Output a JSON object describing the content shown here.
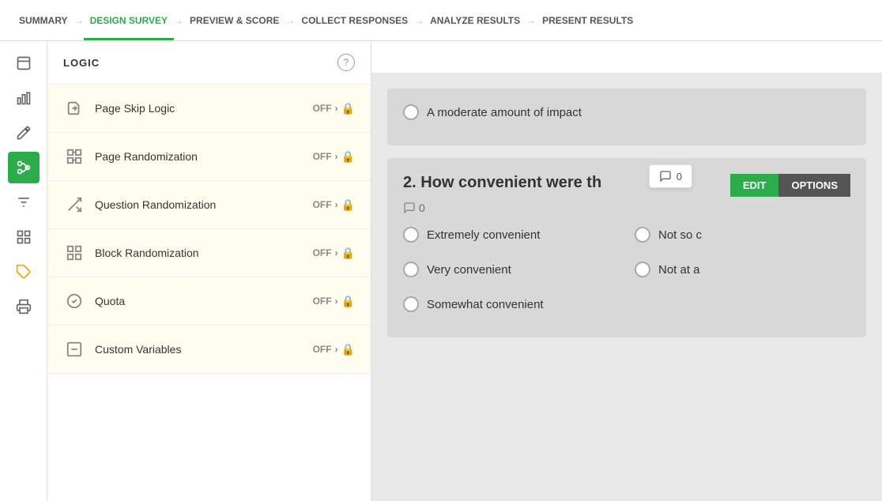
{
  "nav": {
    "items": [
      {
        "id": "summary",
        "label": "SUMMARY",
        "active": false
      },
      {
        "id": "design",
        "label": "DESIGN SURVEY",
        "active": true
      },
      {
        "id": "preview",
        "label": "PREVIEW & SCORE",
        "active": false
      },
      {
        "id": "collect",
        "label": "COLLECT RESPONSES",
        "active": false
      },
      {
        "id": "analyze",
        "label": "ANALYZE RESULTS",
        "active": false
      },
      {
        "id": "present",
        "label": "PRESENT RESULTS",
        "active": false
      }
    ]
  },
  "sidebar": {
    "header": "LOGIC",
    "help_label": "?",
    "items": [
      {
        "id": "page-skip",
        "label": "Page Skip Logic",
        "status": "OFF",
        "icon": "⏭"
      },
      {
        "id": "page-rand",
        "label": "Page Randomization",
        "status": "OFF",
        "icon": "⊞"
      },
      {
        "id": "question-rand",
        "label": "Question Randomization",
        "status": "OFF",
        "icon": "⇄"
      },
      {
        "id": "block-rand",
        "label": "Block Randomization",
        "status": "OFF",
        "icon": "⊠"
      },
      {
        "id": "quota",
        "label": "Quota",
        "status": "OFF",
        "icon": "✓"
      },
      {
        "id": "custom-var",
        "label": "Custom Variables",
        "status": "OFF",
        "icon": "[]"
      }
    ]
  },
  "icon_bar": {
    "items": [
      {
        "id": "inbox",
        "icon": "⊟",
        "active": false
      },
      {
        "id": "chart",
        "icon": "▦",
        "active": false
      },
      {
        "id": "pen",
        "icon": "✏",
        "active": false
      },
      {
        "id": "logic",
        "icon": "✂",
        "active": true
      },
      {
        "id": "filter",
        "icon": "⊞",
        "active": false
      },
      {
        "id": "grid",
        "icon": "⊡",
        "active": false
      },
      {
        "id": "tag",
        "icon": "⬡",
        "active": false
      },
      {
        "id": "print",
        "icon": "⊟",
        "active": false
      }
    ]
  },
  "content": {
    "question1_options": [
      {
        "id": "moderate",
        "label": "A moderate amount of impact"
      }
    ],
    "question2": {
      "number": "2.",
      "title": "How convenient were th",
      "title_full": "How convenient were th...",
      "comment_count": "0",
      "comment_icon": "💬",
      "edit_label": "EDIT",
      "options_label": "OPTIONS",
      "comment_row_count": "0",
      "options": [
        {
          "id": "extremely",
          "label": "Extremely convenient",
          "col": 1
        },
        {
          "id": "not-so",
          "label": "Not so c",
          "col": 2
        },
        {
          "id": "very",
          "label": "Very convenient",
          "col": 1
        },
        {
          "id": "not-at",
          "label": "Not at a",
          "col": 2
        },
        {
          "id": "somewhat",
          "label": "Somewhat convenient",
          "col": 1
        }
      ]
    }
  }
}
